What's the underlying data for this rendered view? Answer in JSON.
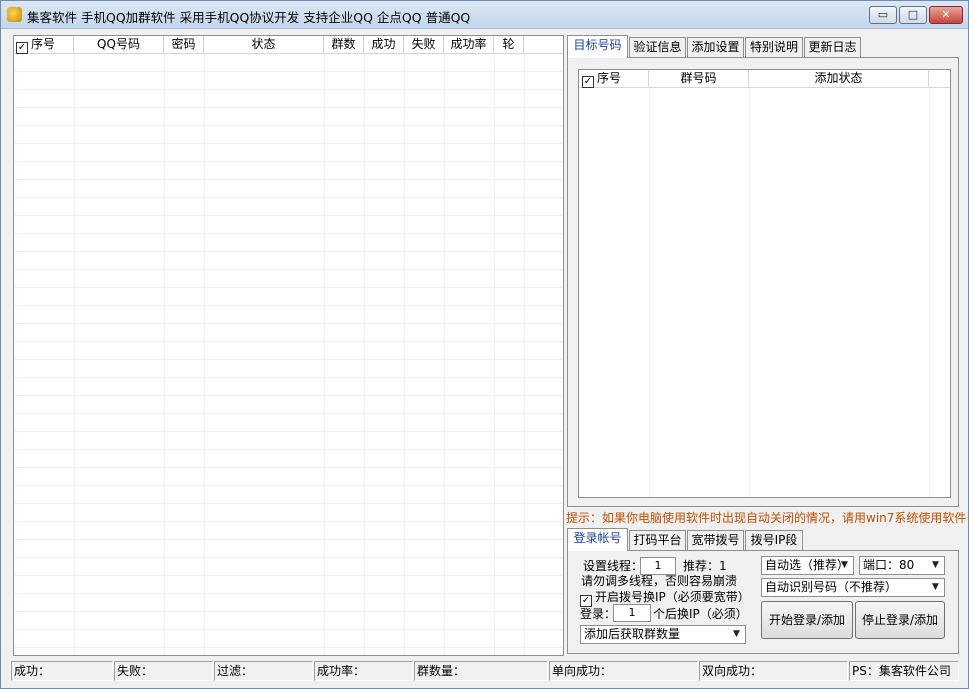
{
  "window": {
    "title": "集客软件 手机QQ加群软件   采用手机QQ协议开发  支持企业QQ  企点QQ  普通QQ",
    "min_glyph": "▭",
    "max_glyph": "□",
    "close_glyph": "✕"
  },
  "left_table": {
    "columns": [
      "序号",
      "QQ号码",
      "密码",
      "状态",
      "群数",
      "成功",
      "失败",
      "成功率",
      "轮"
    ],
    "select_all_checked": true,
    "rows": []
  },
  "right_tabs": {
    "items": [
      "目标号码",
      "验证信息",
      "添加设置",
      "特别说明",
      "更新日志"
    ],
    "active": "目标号码"
  },
  "target_table": {
    "columns": [
      "序号",
      "群号码",
      "添加状态"
    ],
    "select_all_checked": true,
    "rows": []
  },
  "hint": "提示：如果你电脑使用软件时出现自动关闭的情况，请用win7系统使用软件",
  "bottom_tabs": {
    "items": [
      "登录帐号",
      "打码平台",
      "宽带拨号",
      "拨号IP段"
    ],
    "active": "登录帐号"
  },
  "login_panel": {
    "threads_label": "设置线程：",
    "threads_value": "1",
    "recommend_label": "推荐：1",
    "warning": "请勿调多线程，否则容易崩溃",
    "dial_ip_label": "开启拨号换IP（必须要宽带）",
    "dial_ip_checked": true,
    "login_label": "登录：",
    "login_value": "1",
    "switch_ip_suffix": "个后换IP（必须）",
    "fetch_select": "添加后获取群数量",
    "auto_select": "自动选（推荐）",
    "port_select": "端口：80",
    "recognize_select": "自动识别号码（不推荐）",
    "start_button": "开始登录/添加",
    "stop_button": "停止登录/添加"
  },
  "status_bar": {
    "cells": [
      "成功：",
      "失败：",
      "过滤：",
      "成功率：",
      "群数量：",
      "单向成功：",
      "双向成功：",
      "PS：集客软件公司"
    ]
  }
}
